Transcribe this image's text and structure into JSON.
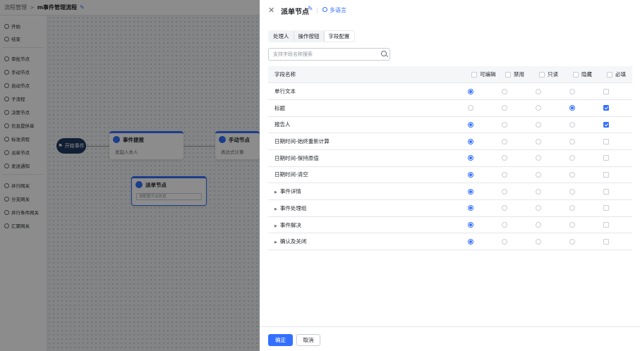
{
  "breadcrumb": {
    "parent": "流程管理",
    "separator": ">",
    "current": "m事件管理流程"
  },
  "sidebar": {
    "items": [
      {
        "label": "开始",
        "icon": "start-icon"
      },
      {
        "label": "结束",
        "icon": "end-icon"
      },
      {
        "label": "审批节点",
        "icon": "approve-icon"
      },
      {
        "label": "手动节点",
        "icon": "manual-icon"
      },
      {
        "label": "自动节点",
        "icon": "auto-icon"
      },
      {
        "label": "子流程",
        "icon": "subflow-icon"
      },
      {
        "label": "决策节点",
        "icon": "decision-icon"
      },
      {
        "label": "信息提供单",
        "icon": "info-icon"
      },
      {
        "label": "标准流程",
        "icon": "standard-icon"
      },
      {
        "label": "派单节点",
        "icon": "dispatch-icon"
      },
      {
        "label": "发送通知",
        "icon": "notify-icon"
      },
      {
        "label": "并行网关",
        "icon": "parallel-gateway-icon"
      },
      {
        "label": "分支网关",
        "icon": "branch-gateway-icon"
      },
      {
        "label": "并行条件网关",
        "icon": "parallel-condition-gateway-icon"
      },
      {
        "label": "汇聚网关",
        "icon": "merge-gateway-icon"
      }
    ]
  },
  "canvas": {
    "start_node": "开始事件",
    "nodes": [
      {
        "title": "事件提报",
        "body": "发起人本人"
      },
      {
        "title": "手动节点",
        "body": "表达式计算"
      },
      {
        "title": "派单节点",
        "body": "请配置节点信息"
      }
    ]
  },
  "drawer": {
    "title": "派单节点",
    "lang_label": "多语言",
    "tabs": [
      {
        "label": "处理人",
        "active": false
      },
      {
        "label": "操作按钮",
        "active": false
      },
      {
        "label": "字段配置",
        "active": true
      }
    ],
    "search_placeholder": "支持字段名称搜索",
    "table": {
      "name_header": "字段名称",
      "columns": [
        "可编辑",
        "禁用",
        "只读",
        "隐藏",
        "必填"
      ],
      "rows": [
        {
          "name": "单行文本",
          "mode": 0,
          "required": false,
          "expandable": false
        },
        {
          "name": "标题",
          "mode": 3,
          "required": true,
          "expandable": false
        },
        {
          "name": "报告人",
          "mode": 0,
          "required": true,
          "expandable": false
        },
        {
          "name": "日期时间-始终重新计算",
          "mode": 0,
          "required": false,
          "expandable": false
        },
        {
          "name": "日期时间-保持原值",
          "mode": 0,
          "required": false,
          "expandable": false
        },
        {
          "name": "日期时间-清空",
          "mode": 0,
          "required": false,
          "expandable": false
        },
        {
          "name": "事件详情",
          "mode": 0,
          "required": false,
          "expandable": true
        },
        {
          "name": "事件处理组",
          "mode": 0,
          "required": false,
          "expandable": true
        },
        {
          "name": "事件解决",
          "mode": 0,
          "required": false,
          "expandable": true
        },
        {
          "name": "确认及关闭",
          "mode": 0,
          "required": false,
          "expandable": true
        }
      ]
    },
    "footer": {
      "confirm": "确定",
      "cancel": "取消"
    }
  },
  "colors": {
    "accent": "#3370ff",
    "mask": "rgba(0,0,0,0.45)"
  }
}
